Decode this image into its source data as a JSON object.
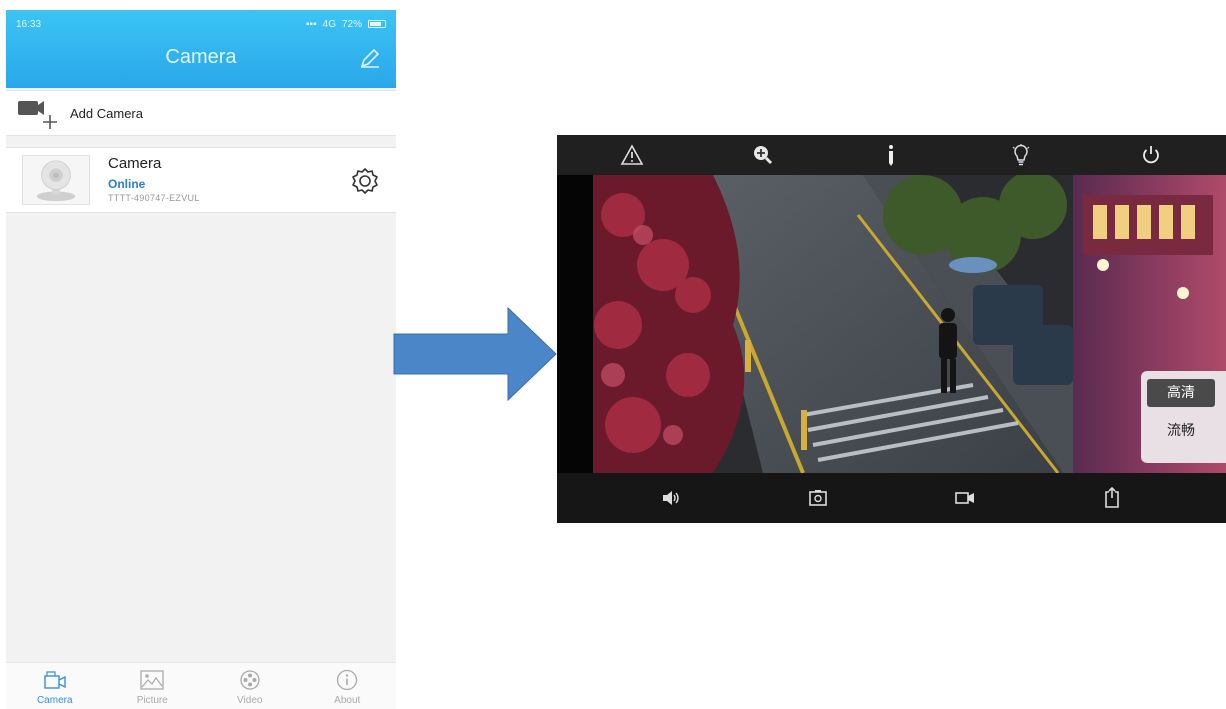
{
  "status_bar": {
    "time": "16:33",
    "network": "4G",
    "battery": "72%"
  },
  "app": {
    "title": "Camera"
  },
  "add_camera": {
    "label": "Add Camera"
  },
  "camera": {
    "name": "Camera",
    "status": "Online",
    "id": "TTTT-490747-EZVUL"
  },
  "tabs": [
    {
      "label": "Camera",
      "icon": "camera-tab-icon",
      "active": true
    },
    {
      "label": "Picture",
      "icon": "picture-icon",
      "active": false
    },
    {
      "label": "Video",
      "icon": "film-reel-icon",
      "active": false
    },
    {
      "label": "About",
      "icon": "info-icon",
      "active": false
    }
  ],
  "player": {
    "top_controls": [
      "warning-icon",
      "zoom-in-icon",
      "tilt-icon",
      "light-bulb-icon",
      "power-icon"
    ],
    "bottom_controls": [
      "speaker-icon",
      "snapshot-icon",
      "record-icon",
      "share-icon"
    ],
    "quality_options": [
      {
        "label": "高清",
        "selected": true
      },
      {
        "label": "流畅",
        "selected": false
      }
    ]
  },
  "colors": {
    "accent": "#2aa7ea",
    "online": "#2a7fd0",
    "arrow": "#4a86c8"
  }
}
